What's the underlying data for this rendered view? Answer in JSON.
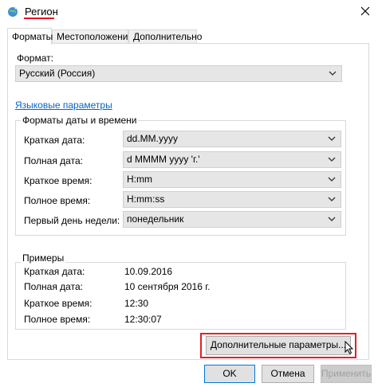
{
  "window": {
    "title": "Регион",
    "icon": "globe-icon",
    "close_icon": "close-icon"
  },
  "tabs": [
    {
      "label": "Форматы",
      "active": true
    },
    {
      "label": "Местоположение",
      "active": false
    },
    {
      "label": "Дополнительно",
      "active": false
    }
  ],
  "format": {
    "label": "Формат:",
    "value": "Русский (Россия)"
  },
  "language_link": "Языковые параметры",
  "date_time_group": {
    "title": "Форматы даты и времени",
    "rows": [
      {
        "label": "Краткая дата:",
        "value": "dd.MM.yyyy"
      },
      {
        "label": "Полная дата:",
        "value": "d MMMM yyyy 'г.'"
      },
      {
        "label": "Краткое время:",
        "value": "H:mm"
      },
      {
        "label": "Полное время:",
        "value": "H:mm:ss"
      },
      {
        "label": "Первый день недели:",
        "value": "понедельник"
      }
    ]
  },
  "examples_group": {
    "title": "Примеры",
    "rows": [
      {
        "label": "Краткая дата:",
        "value": "10.09.2016"
      },
      {
        "label": "Полная дата:",
        "value": "10 сентября 2016 г."
      },
      {
        "label": "Краткое время:",
        "value": "12:30"
      },
      {
        "label": "Полное время:",
        "value": "12:30:07"
      }
    ]
  },
  "advanced_button": "Дополнительные параметры...",
  "buttons": {
    "ok": "OK",
    "cancel": "Отмена",
    "apply": "Применить"
  },
  "colors": {
    "highlight": "#e0202a",
    "link": "#0066cc",
    "accent": "#0078d7"
  }
}
